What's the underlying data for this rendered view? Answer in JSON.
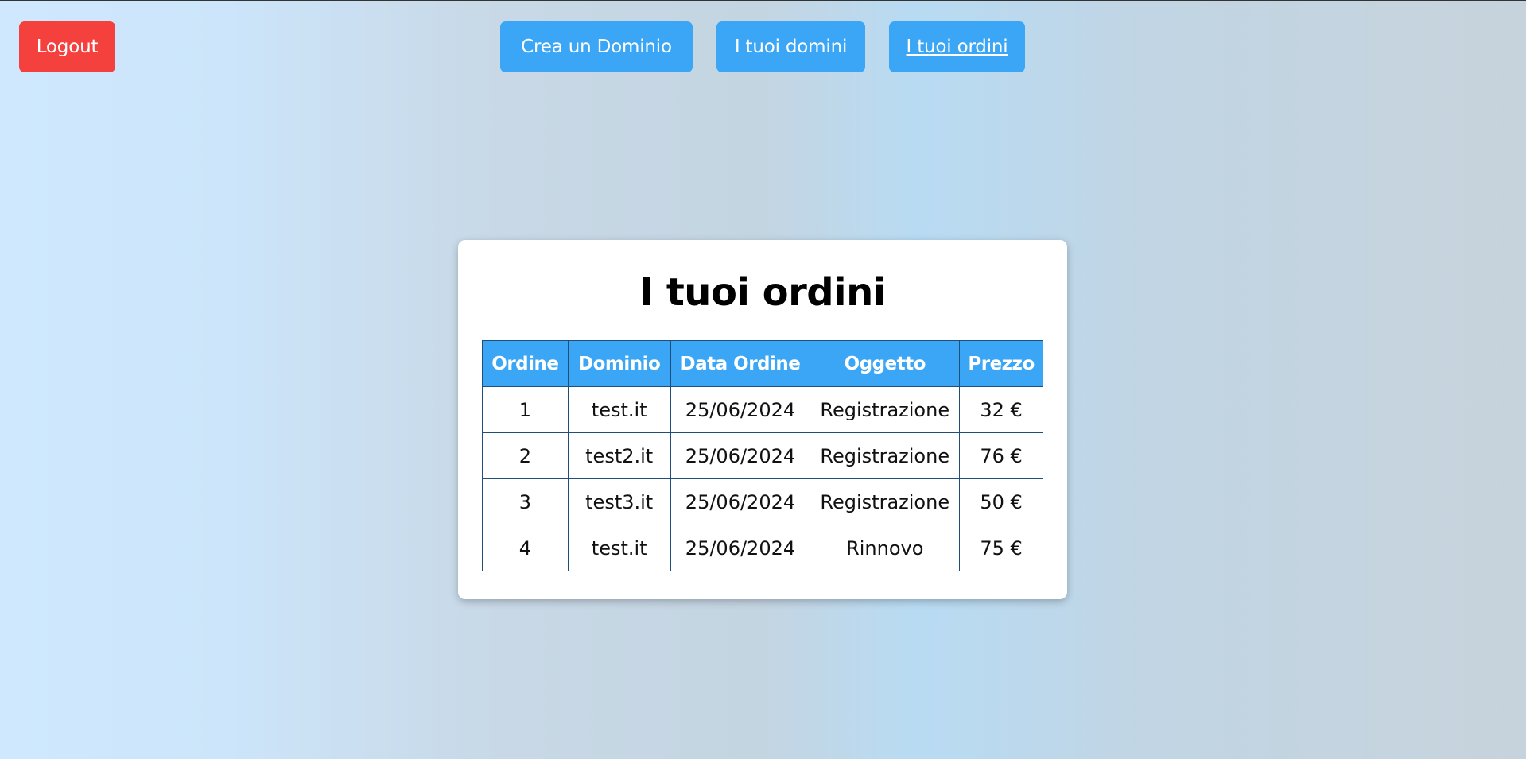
{
  "header": {
    "logout_label": "Logout",
    "nav": {
      "create_label": "Crea un Dominio",
      "domains_label": "I tuoi domini",
      "orders_label": "I tuoi ordini"
    }
  },
  "colors": {
    "logout": "#f5413e",
    "accent": "#3aa6f5",
    "table_border": "#1f4e79"
  },
  "orders": {
    "title": "I tuoi ordini",
    "columns": [
      "Ordine",
      "Dominio",
      "Data Ordine",
      "Oggetto",
      "Prezzo"
    ],
    "rows": [
      [
        "1",
        "test.it",
        "25/06/2024",
        "Registrazione",
        "32 €"
      ],
      [
        "2",
        "test2.it",
        "25/06/2024",
        "Registrazione",
        "76 €"
      ],
      [
        "3",
        "test3.it",
        "25/06/2024",
        "Registrazione",
        "50 €"
      ],
      [
        "4",
        "test.it",
        "25/06/2024",
        "Rinnovo",
        "75 €"
      ]
    ]
  }
}
